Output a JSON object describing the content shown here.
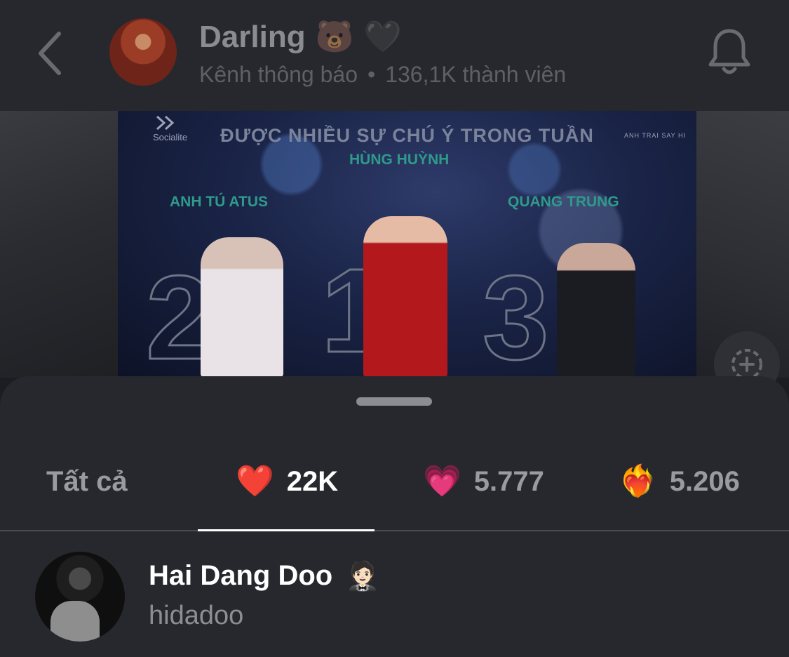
{
  "header": {
    "back_icon": "chevron-left-icon",
    "channel_name": "Darling",
    "channel_emojis": "🐻 🖤",
    "channel_type": "Kênh thông báo",
    "separator": "•",
    "member_count": "136,1K thành viên",
    "bell_icon": "bell-icon"
  },
  "post_image": {
    "logo_left": "Socialite",
    "logo_right": "ANH TRAI SAY HI",
    "headline": "ĐƯỢC NHIỀU SỰ CHÚ Ý TRONG TUẦN",
    "rank1_name": "HÙNG HUỲNH",
    "rank2_name": "ANH TÚ ATUS",
    "rank3_name": "QUANG TRUNG",
    "rank1": "1",
    "rank2": "2",
    "rank3": "3"
  },
  "add_reaction_icon": "add-reaction-icon",
  "reactions_sheet": {
    "tabs": [
      {
        "label": "Tất cả"
      },
      {
        "emoji": "❤️",
        "count": "22K"
      },
      {
        "emoji": "💗",
        "count": "5.777"
      },
      {
        "emoji": "❤️‍🔥",
        "count": "5.206"
      }
    ],
    "active_tab": 1,
    "users": [
      {
        "name": "Hai Dang Doo",
        "emoji": "🤵🏻",
        "handle": "hidadoo"
      }
    ]
  },
  "colors": {
    "sheet_bg": "#27282e",
    "header_bg": "#27282e",
    "active_text": "#ffffff",
    "inactive_text": "#9a9ba0"
  }
}
